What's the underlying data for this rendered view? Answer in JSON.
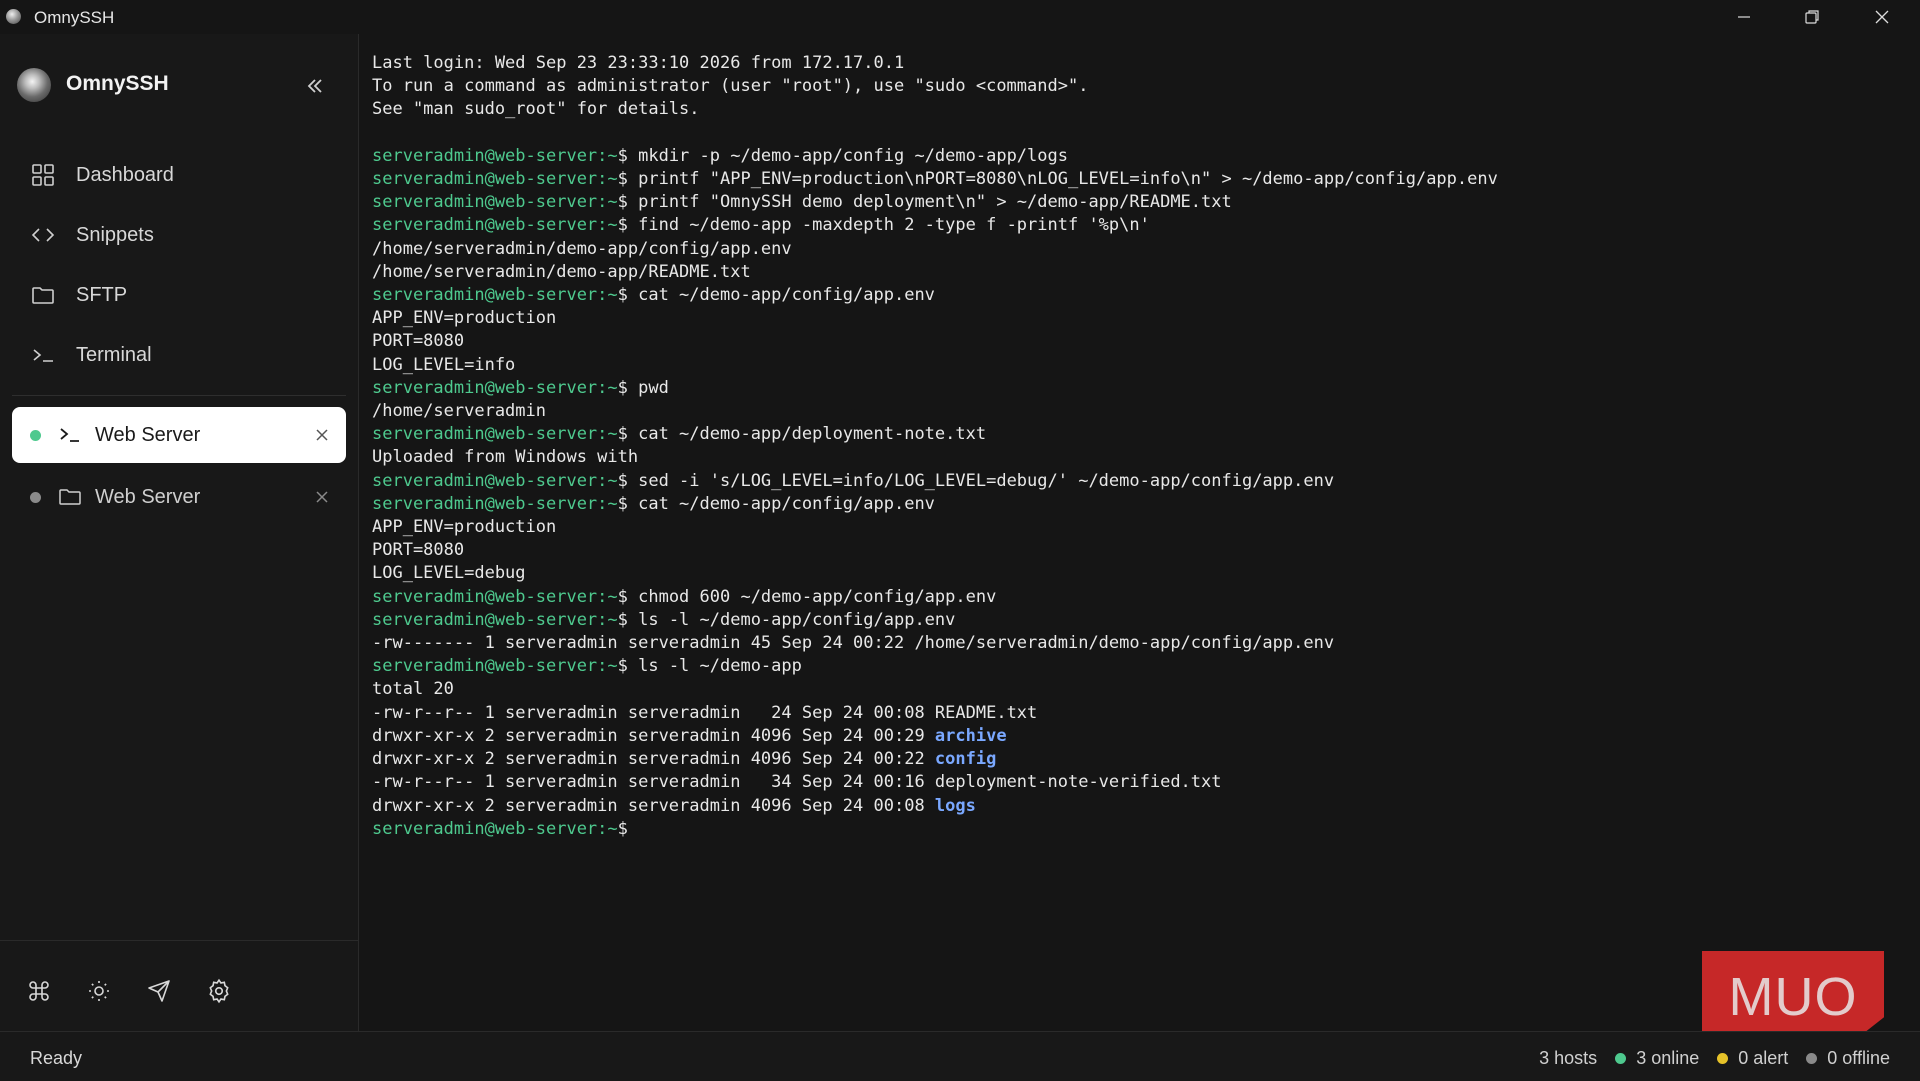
{
  "window": {
    "title": "OmnySSH"
  },
  "sidebar": {
    "brand": "OmnySSH",
    "nav": [
      {
        "label": "Dashboard",
        "icon": "grid-icon"
      },
      {
        "label": "Snippets",
        "icon": "code-icon"
      },
      {
        "label": "SFTP",
        "icon": "folder-icon"
      },
      {
        "label": "Terminal",
        "icon": "terminal-icon"
      }
    ],
    "sessions": [
      {
        "label": "Web Server",
        "type": "terminal",
        "status_color": "#4ec98e",
        "active": true
      },
      {
        "label": "Web Server",
        "type": "sftp",
        "status_color": "#8a8a8a",
        "active": false
      }
    ],
    "tools": [
      "command-icon",
      "theme-icon",
      "send-icon",
      "settings-icon"
    ]
  },
  "terminal": {
    "lines": [
      {
        "t": "text",
        "v": "Last login: Wed Sep 23 23:33:10 2026 from 172.17.0.1"
      },
      {
        "t": "text",
        "v": "To run a command as administrator (user \"root\"), use \"sudo <command>\"."
      },
      {
        "t": "text",
        "v": "See \"man sudo_root\" for details."
      },
      {
        "t": "text",
        "v": ""
      },
      {
        "t": "cmd",
        "p": "serveradmin@web-server",
        "c": "mkdir -p ~/demo-app/config ~/demo-app/logs"
      },
      {
        "t": "cmd",
        "p": "serveradmin@web-server",
        "c": "printf \"APP_ENV=production\\nPORT=8080\\nLOG_LEVEL=info\\n\" > ~/demo-app/config/app.env"
      },
      {
        "t": "cmd",
        "p": "serveradmin@web-server",
        "c": "printf \"OmnySSH demo deployment\\n\" > ~/demo-app/README.txt"
      },
      {
        "t": "cmd",
        "p": "serveradmin@web-server",
        "c": "find ~/demo-app -maxdepth 2 -type f -printf '%p\\n'"
      },
      {
        "t": "text",
        "v": "/home/serveradmin/demo-app/config/app.env"
      },
      {
        "t": "text",
        "v": "/home/serveradmin/demo-app/README.txt"
      },
      {
        "t": "cmd",
        "p": "serveradmin@web-server",
        "c": "cat ~/demo-app/config/app.env"
      },
      {
        "t": "text",
        "v": "APP_ENV=production"
      },
      {
        "t": "text",
        "v": "PORT=8080"
      },
      {
        "t": "text",
        "v": "LOG_LEVEL=info"
      },
      {
        "t": "cmd",
        "p": "serveradmin@web-server",
        "c": "pwd"
      },
      {
        "t": "text",
        "v": "/home/serveradmin"
      },
      {
        "t": "cmd",
        "p": "serveradmin@web-server",
        "c": "cat ~/demo-app/deployment-note.txt"
      },
      {
        "t": "text",
        "v": "Uploaded from Windows with"
      },
      {
        "t": "cmd",
        "p": "serveradmin@web-server",
        "c": "sed -i 's/LOG_LEVEL=info/LOG_LEVEL=debug/' ~/demo-app/config/app.env"
      },
      {
        "t": "cmd",
        "p": "serveradmin@web-server",
        "c": "cat ~/demo-app/config/app.env"
      },
      {
        "t": "text",
        "v": "APP_ENV=production"
      },
      {
        "t": "text",
        "v": "PORT=8080"
      },
      {
        "t": "text",
        "v": "LOG_LEVEL=debug"
      },
      {
        "t": "cmd",
        "p": "serveradmin@web-server",
        "c": "chmod 600 ~/demo-app/config/app.env"
      },
      {
        "t": "cmd",
        "p": "serveradmin@web-server",
        "c": "ls -l ~/demo-app/config/app.env"
      },
      {
        "t": "text",
        "v": "-rw------- 1 serveradmin serveradmin 45 Sep 24 00:22 /home/serveradmin/demo-app/config/app.env"
      },
      {
        "t": "cmd",
        "p": "serveradmin@web-server",
        "c": "ls -l ~/demo-app"
      },
      {
        "t": "text",
        "v": "total 20"
      },
      {
        "t": "ls",
        "v": "-rw-r--r-- 1 serveradmin serveradmin   24 Sep 24 00:08 ",
        "n": "README.txt",
        "d": false
      },
      {
        "t": "ls",
        "v": "drwxr-xr-x 2 serveradmin serveradmin 4096 Sep 24 00:29 ",
        "n": "archive",
        "d": true
      },
      {
        "t": "ls",
        "v": "drwxr-xr-x 2 serveradmin serveradmin 4096 Sep 24 00:22 ",
        "n": "config",
        "d": true
      },
      {
        "t": "ls",
        "v": "-rw-r--r-- 1 serveradmin serveradmin   34 Sep 24 00:16 ",
        "n": "deployment-note-verified.txt",
        "d": false
      },
      {
        "t": "ls",
        "v": "drwxr-xr-x 2 serveradmin serveradmin 4096 Sep 24 00:08 ",
        "n": "logs",
        "d": true
      },
      {
        "t": "cmd",
        "p": "serveradmin@web-server",
        "c": ""
      }
    ]
  },
  "statusbar": {
    "left": "Ready",
    "hosts": "3 hosts",
    "online": "3 online",
    "alert": "0 alert",
    "offline": "0 offline",
    "colors": {
      "online": "#4ec98e",
      "alert": "#e6c229",
      "offline": "#8a8a8a"
    }
  },
  "watermark": "MUO"
}
